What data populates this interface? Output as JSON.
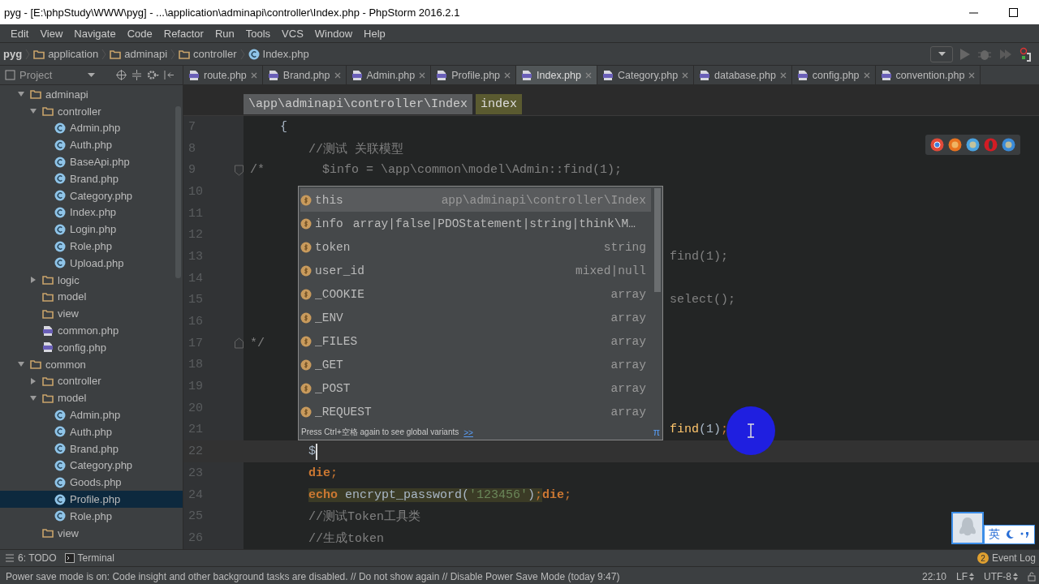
{
  "window": {
    "title": "pyg - [E:\\phpStudy\\WWW\\pyg] - ...\\application\\adminapi\\controller\\Index.php - PhpStorm 2016.2.1"
  },
  "menu": [
    "Edit",
    "View",
    "Navigate",
    "Code",
    "Refactor",
    "Run",
    "Tools",
    "VCS",
    "Window",
    "Help"
  ],
  "navbar": {
    "crumbs": [
      {
        "label": "pyg",
        "kind": "project"
      },
      {
        "label": "application",
        "kind": "folder"
      },
      {
        "label": "adminapi",
        "kind": "folder"
      },
      {
        "label": "controller",
        "kind": "folder"
      },
      {
        "label": "Index.php",
        "kind": "class"
      }
    ]
  },
  "project_panel": {
    "title": "Project",
    "tree": [
      {
        "label": "adminapi",
        "kind": "folder",
        "expanded": true,
        "selected": false,
        "children": [
          {
            "label": "controller",
            "kind": "folder",
            "expanded": true,
            "selected": false,
            "children": [
              {
                "label": "Admin.php",
                "kind": "class",
                "selected": false
              },
              {
                "label": "Auth.php",
                "kind": "class",
                "selected": false
              },
              {
                "label": "BaseApi.php",
                "kind": "class",
                "selected": false
              },
              {
                "label": "Brand.php",
                "kind": "class",
                "selected": false
              },
              {
                "label": "Category.php",
                "kind": "class",
                "selected": false
              },
              {
                "label": "Index.php",
                "kind": "class",
                "selected": false
              },
              {
                "label": "Login.php",
                "kind": "class",
                "selected": false
              },
              {
                "label": "Role.php",
                "kind": "class",
                "selected": false
              },
              {
                "label": "Upload.php",
                "kind": "class",
                "selected": false
              }
            ]
          },
          {
            "label": "logic",
            "kind": "folder",
            "expanded": false,
            "selected": false
          },
          {
            "label": "model",
            "kind": "folder",
            "selected": false
          },
          {
            "label": "view",
            "kind": "folder",
            "selected": false
          },
          {
            "label": "common.php",
            "kind": "php",
            "selected": false
          },
          {
            "label": "config.php",
            "kind": "php",
            "selected": false
          }
        ]
      },
      {
        "label": "common",
        "kind": "folder",
        "expanded": true,
        "selected": false,
        "children": [
          {
            "label": "controller",
            "kind": "folder",
            "expanded": false,
            "selected": false
          },
          {
            "label": "model",
            "kind": "folder",
            "expanded": true,
            "selected": false,
            "children": [
              {
                "label": "Admin.php",
                "kind": "class",
                "selected": false
              },
              {
                "label": "Auth.php",
                "kind": "class",
                "selected": false
              },
              {
                "label": "Brand.php",
                "kind": "class",
                "selected": false
              },
              {
                "label": "Category.php",
                "kind": "class",
                "selected": false
              },
              {
                "label": "Goods.php",
                "kind": "class",
                "selected": false
              },
              {
                "label": "Profile.php",
                "kind": "class",
                "selected": true
              },
              {
                "label": "Role.php",
                "kind": "class",
                "selected": false
              }
            ]
          },
          {
            "label": "view",
            "kind": "folder",
            "selected": false
          }
        ]
      }
    ]
  },
  "tabs": [
    {
      "label": "route.php",
      "selected": false
    },
    {
      "label": "Brand.php",
      "selected": false
    },
    {
      "label": "Admin.php",
      "selected": false
    },
    {
      "label": "Profile.php",
      "selected": false
    },
    {
      "label": "Index.php",
      "selected": true
    },
    {
      "label": "Category.php",
      "selected": false
    },
    {
      "label": "database.php",
      "selected": false
    },
    {
      "label": "config.php",
      "selected": false
    },
    {
      "label": "convention.php",
      "selected": false
    }
  ],
  "editor": {
    "breadcrumb": [
      {
        "label": "\\app\\adminapi\\controller\\Index",
        "kind": "class"
      },
      {
        "label": "index",
        "kind": "method"
      }
    ],
    "lines": [
      {
        "number": "7",
        "kind": "outer",
        "current": false,
        "tokens": [
          {
            "text": "{",
            "kind": "code"
          }
        ]
      },
      {
        "number": "8",
        "kind": "inner",
        "current": false,
        "tokens": [
          {
            "text": "//测试 关联模型",
            "kind": "comment"
          }
        ]
      },
      {
        "number": "9",
        "kind": "nested",
        "current": false,
        "fold": "/*",
        "tokens": [
          {
            "text": "$info = \\app\\common\\model\\Admin::find(1);",
            "kind": "comment"
          }
        ]
      },
      {
        "number": "10",
        "current": false
      },
      {
        "number": "11",
        "current": false
      },
      {
        "number": "12",
        "current": false
      },
      {
        "number": "13",
        "kind": "tail",
        "current": false,
        "tokens": [
          {
            "text": "find(1);",
            "kind": "comment"
          }
        ]
      },
      {
        "number": "14",
        "current": false
      },
      {
        "number": "15",
        "kind": "tail",
        "current": false,
        "tokens": [
          {
            "text": "select();",
            "kind": "comment"
          }
        ]
      },
      {
        "number": "16",
        "current": false
      },
      {
        "number": "17",
        "current": false,
        "fold": "*/"
      },
      {
        "number": "18",
        "current": false
      },
      {
        "number": "19",
        "current": false
      },
      {
        "number": "20",
        "current": false
      },
      {
        "number": "21",
        "kind": "tail",
        "current": false,
        "tokens": [
          {
            "text": "find",
            "kind": "func"
          },
          {
            "text": "(1)",
            "kind": "code"
          },
          {
            "text": ";",
            "kind": "punct"
          }
        ]
      },
      {
        "number": "22",
        "kind": "inner",
        "current": true,
        "tokens": [
          {
            "text": "$",
            "kind": "code"
          }
        ]
      },
      {
        "number": "23",
        "kind": "inner",
        "current": false,
        "tokens": [
          {
            "text": "die",
            "kind": "keyword"
          },
          {
            "text": ";",
            "kind": "punct"
          }
        ]
      },
      {
        "number": "24",
        "kind": "inner",
        "current": false,
        "tokens": [
          {
            "text": "echo",
            "kind": "keyword",
            "highlighted": true
          },
          {
            "text": " encrypt_password(",
            "kind": "code",
            "highlighted": true
          },
          {
            "text": "'123456'",
            "kind": "string",
            "highlighted": true
          },
          {
            "text": ")",
            "kind": "code",
            "highlighted": true
          },
          {
            "text": ";",
            "kind": "punct",
            "highlighted": true
          },
          {
            "text": "die",
            "kind": "keyword"
          },
          {
            "text": ";",
            "kind": "punct"
          }
        ]
      },
      {
        "number": "25",
        "kind": "inner",
        "current": false,
        "tokens": [
          {
            "text": "//测试Token工具类",
            "kind": "comment"
          }
        ]
      },
      {
        "number": "26",
        "kind": "inner",
        "current": false,
        "tokens": [
          {
            "text": "//生成token",
            "kind": "comment"
          }
        ]
      }
    ],
    "completion": {
      "items": [
        {
          "name": "this",
          "type": "app\\adminapi\\controller\\Index",
          "selected": true
        },
        {
          "name": "info",
          "type": "array|false|PDOStatement|string|think\\M…",
          "selected": false
        },
        {
          "name": "token",
          "type": "string",
          "selected": false
        },
        {
          "name": "user_id",
          "type": "mixed|null",
          "selected": false
        },
        {
          "name": "_COOKIE",
          "type": "array",
          "selected": false
        },
        {
          "name": "_ENV",
          "type": "array",
          "selected": false
        },
        {
          "name": "_FILES",
          "type": "array",
          "selected": false
        },
        {
          "name": "_GET",
          "type": "array",
          "selected": false
        },
        {
          "name": "_POST",
          "type": "array",
          "selected": false
        },
        {
          "name": "_REQUEST",
          "type": "array",
          "selected": false
        }
      ],
      "hint": "Press Ctrl+空格 again to see global variants",
      "hint_link": ">>",
      "corner": "π"
    }
  },
  "ime": {
    "label": "英"
  },
  "tool_strip": {
    "buttons": [
      {
        "label": "6: TODO",
        "kind": "todo"
      },
      {
        "label": "Terminal",
        "kind": "terminal"
      }
    ],
    "event_log": {
      "count": "2",
      "label": "Event Log"
    }
  },
  "status_bar": {
    "message": "Power save mode is on: Code insight and other background tasks are disabled. // Do not show again // Disable Power Save Mode (today 9:47)",
    "position": "22:10",
    "line_separator": "LF",
    "encoding": "UTF-8"
  }
}
